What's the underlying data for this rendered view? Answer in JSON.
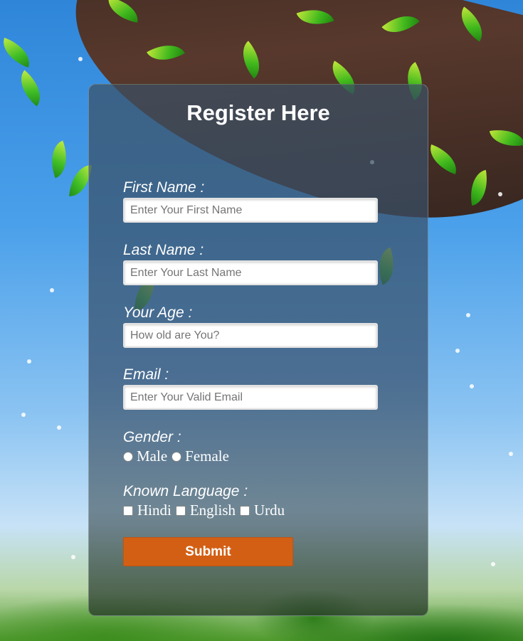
{
  "form": {
    "title": "Register Here",
    "first_name": {
      "label": "First Name :",
      "placeholder": "Enter Your First Name"
    },
    "last_name": {
      "label": "Last Name :",
      "placeholder": "Enter Your Last Name"
    },
    "age": {
      "label": "Your Age :",
      "placeholder": "How old are You?"
    },
    "email": {
      "label": "Email :",
      "placeholder": "Enter Your Valid Email"
    },
    "gender": {
      "label": "Gender :",
      "options": [
        "Male",
        "Female"
      ]
    },
    "language": {
      "label": "Known Language :",
      "options": [
        "Hindi",
        "English",
        "Urdu"
      ]
    },
    "submit_label": "Submit"
  },
  "colors": {
    "submit_button": "#d35f14"
  }
}
